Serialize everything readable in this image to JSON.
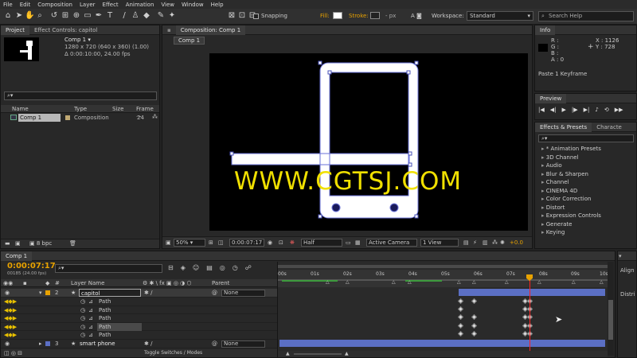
{
  "menu": [
    "File",
    "Edit",
    "Composition",
    "Layer",
    "Effect",
    "Animation",
    "View",
    "Window",
    "Help"
  ],
  "toolbar": {
    "snapping": "Snapping",
    "fill": "Fill:",
    "stroke": "Stroke:",
    "stroke_unit": "- px",
    "workspace_label": "Workspace:",
    "workspace_value": "Standard",
    "search_placeholder": "Search Help"
  },
  "project": {
    "tab_project": "Project",
    "tab_effect_controls": "Effect Controls: capitol",
    "comp_name": "Comp 1 ▾",
    "comp_size": "1280 x 720  (640 x 360) (1.00)",
    "comp_duration": "Δ 0:00:10:00, 24.00 fps",
    "search_placeholder": "⌕▾",
    "col_name": "Name",
    "col_type": "Type",
    "col_size": "Size",
    "col_frame": "Frame ...",
    "items": [
      {
        "name": "Comp 1",
        "type": "Composition",
        "frame": "24"
      }
    ],
    "bpc": "8 bpc"
  },
  "composition": {
    "tab": "Composition: Comp 1",
    "breadcrumb": "Comp 1",
    "watermark": "WWW.CGTSJ.COM",
    "zoom": "50%",
    "timecode": "0:00:07:17",
    "resolution": "Half",
    "camera": "Active Camera",
    "view": "1 View",
    "exposure": "+0.0"
  },
  "info": {
    "tab": "Info",
    "r": "R :",
    "g": "G :",
    "b": "B :",
    "a": "A :  0",
    "x": "X : 1126",
    "y": "Y : 728",
    "status": "Paste 1 Keyframe"
  },
  "preview": {
    "tab": "Preview"
  },
  "effects": {
    "tab": "Effects & Presets",
    "tab2": "Characte",
    "search_placeholder": "⌕▾",
    "items": [
      "* Animation Presets",
      "3D Channel",
      "Audio",
      "Blur & Sharpen",
      "Channel",
      "CINEMA 4D",
      "Color Correction",
      "Distort",
      "Expression Controls",
      "Generate",
      "Keying"
    ]
  },
  "timeline": {
    "tab": "Comp 1",
    "timecode": "0:00:07:17",
    "frame_info": "00185 (24.00 fps)",
    "col_layer_name": "Layer Name",
    "col_parent": "Parent",
    "ruler": [
      "00s",
      "01s",
      "02s",
      "03s",
      "04s",
      "05s",
      "06s",
      "07s",
      "08s",
      "09s",
      "10s"
    ],
    "layers": [
      {
        "num": "2",
        "name": "capitol",
        "parent": "None"
      },
      {
        "num": "3",
        "name": "smart phone",
        "parent": "None"
      }
    ],
    "paths": [
      "Path",
      "Path",
      "Path",
      "Path",
      "Path"
    ],
    "toggle_label": "Toggle Switches / Modes"
  },
  "right_side": {
    "align": "Align",
    "distribute": "Distri"
  },
  "colors": {
    "accent_orange": "#e8a200",
    "watermark": "#f0e000",
    "playhead": "#ff2020",
    "bar_blue": "#5b6fc4",
    "work_area_green": "#3c9a3c"
  }
}
